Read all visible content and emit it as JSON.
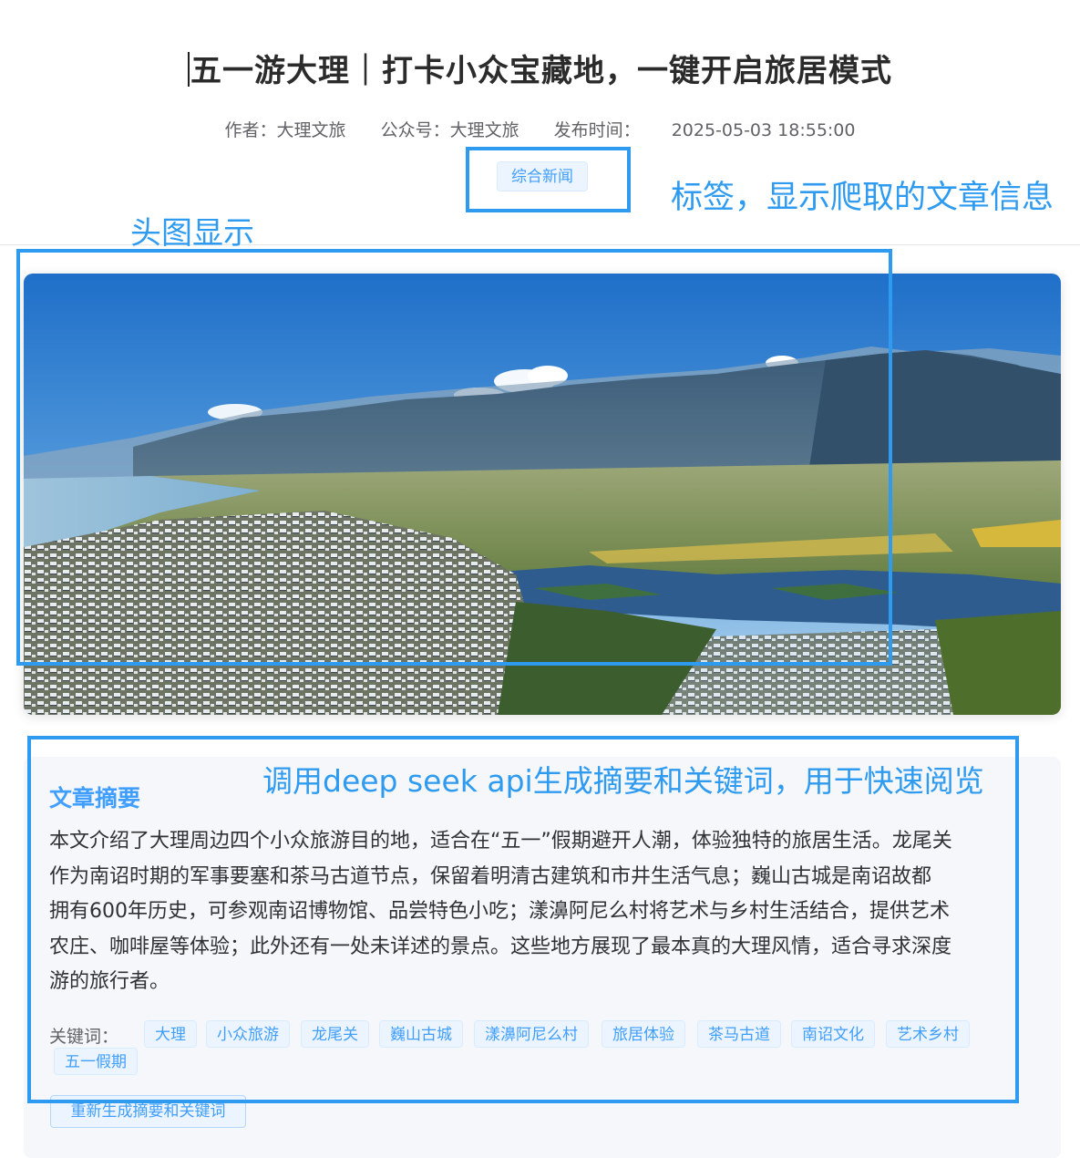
{
  "article": {
    "title": "五一游大理｜打卡小众宝藏地，一键开启旅居模式",
    "author": "作者：大理文旅",
    "account": "公众号：大理文旅",
    "publish_label": "发布时间：",
    "publish_time": "2025-05-03 18:55:00",
    "category_tag": "综合新闻"
  },
  "summary": {
    "heading": "文章摘要",
    "lines": [
      "本文介绍了大理周边四个小众旅游目的地，适合在“五一”假期避开人潮，体验独特的旅居生活。龙尾关",
      "作为南诏时期的军事要塞和茶马古道节点，保留着明清古建筑和市井生活气息；巍山古城是南诏故都",
      "拥有600年历史，可参观南诏博物馆、品尝特色小吃；漾濞阿尼么村将艺术与乡村生活结合，提供艺术",
      "农庄、咖啡屋等体验；此外还有一处未详述的景点。这些地方展现了最本真的大理风情，适合寻求深度",
      "游的旅行者。"
    ],
    "keywords_label": "关键词：",
    "keywords": [
      "大理",
      "小众旅游",
      "龙尾关",
      "巍山古城",
      "漾濞阿尼么村",
      "旅居体验",
      "茶马古道",
      "南诏文化",
      "艺术乡村",
      "五一假期"
    ],
    "regenerate_label": "重新生成摘要和关键词"
  },
  "annotations": {
    "tag_note": "标签，显示爬取的文章信息",
    "image_note": "头图显示",
    "summary_note": "调用deep seek api生成摘要和关键词，用于快速阅览"
  },
  "colors": {
    "accent": "#409eff",
    "annotation": "#2e9bf0"
  }
}
